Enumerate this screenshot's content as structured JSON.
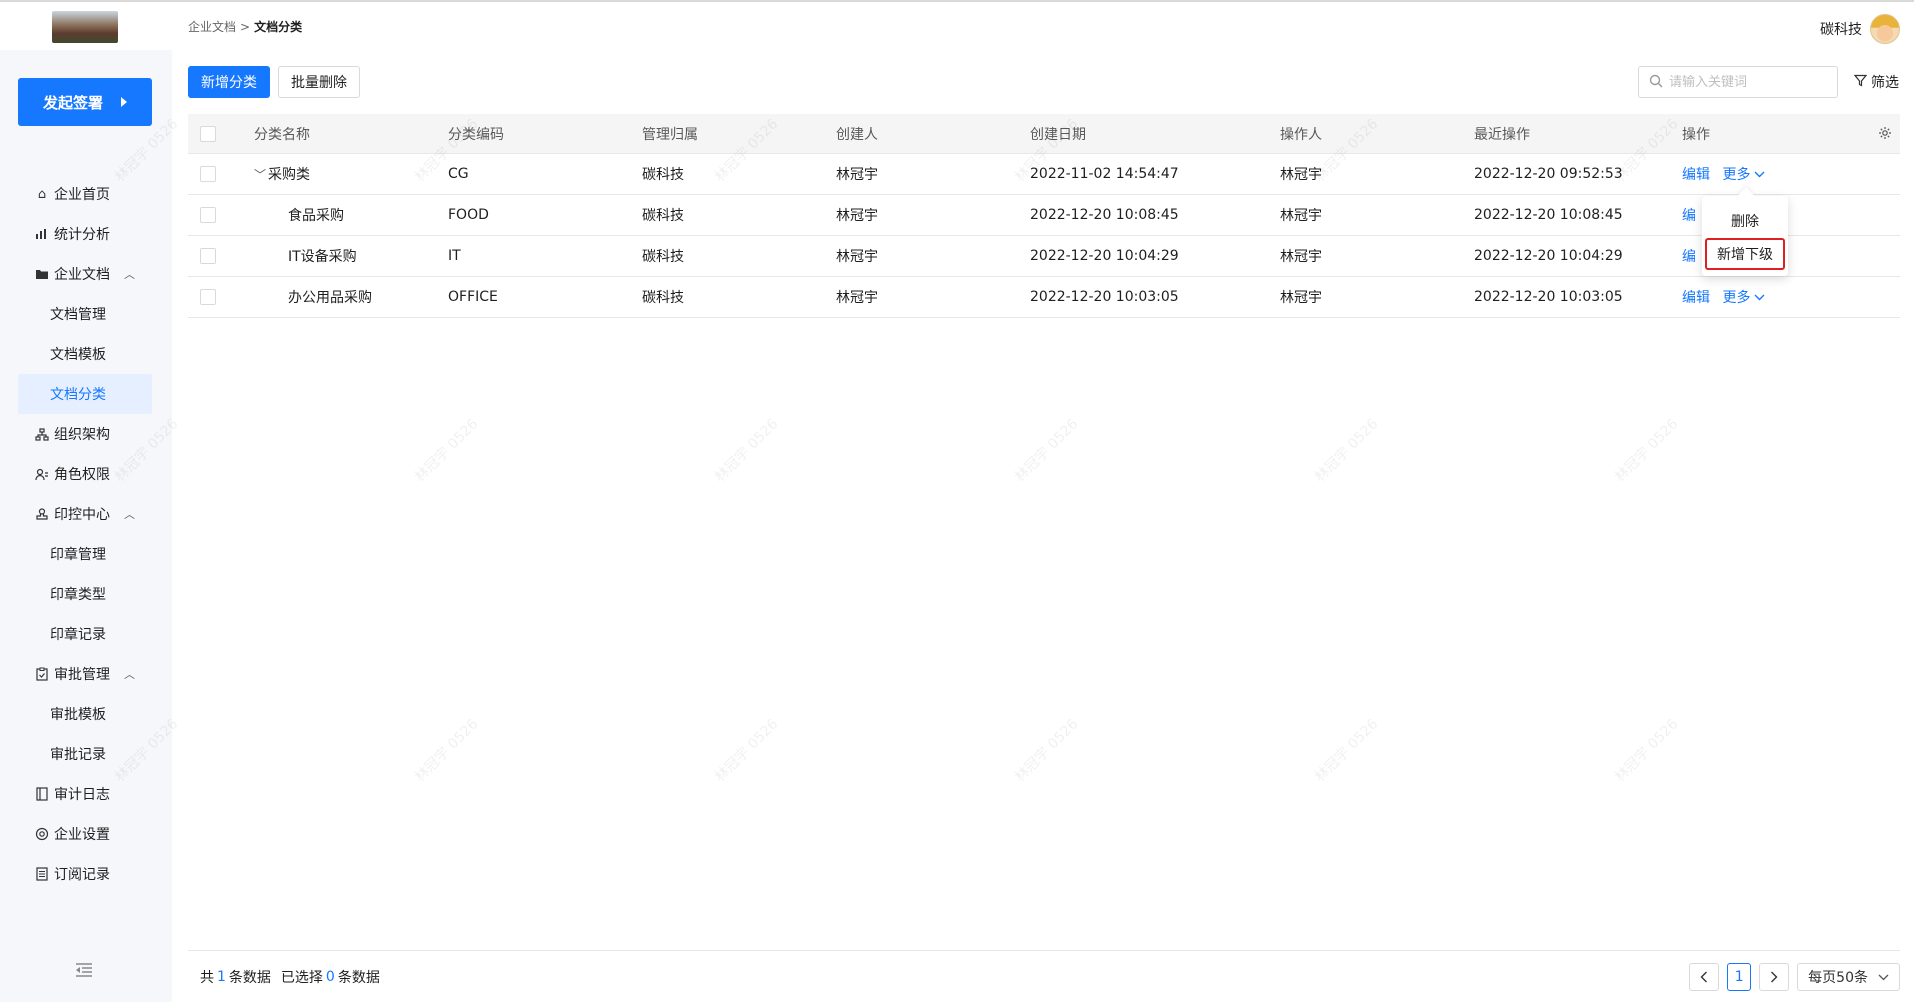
{
  "header": {
    "breadcrumb": [
      "企业文档",
      "文档分类"
    ],
    "breadcrumb_sep": ">",
    "company": "碳科技"
  },
  "sidebar": {
    "launch_label": "发起签署",
    "items": [
      {
        "label": "企业首页",
        "icon": "home-icon"
      },
      {
        "label": "统计分析",
        "icon": "chart-icon"
      },
      {
        "label": "企业文档",
        "icon": "folder-icon",
        "expanded": true
      },
      {
        "label": "文档管理",
        "sub": true
      },
      {
        "label": "文档模板",
        "sub": true
      },
      {
        "label": "文档分类",
        "sub": true,
        "active": true
      },
      {
        "label": "组织架构",
        "icon": "org-icon"
      },
      {
        "label": "角色权限",
        "icon": "role-icon"
      },
      {
        "label": "印控中心",
        "icon": "stamp-icon",
        "expanded": true
      },
      {
        "label": "印章管理",
        "sub": true
      },
      {
        "label": "印章类型",
        "sub": true
      },
      {
        "label": "印章记录",
        "sub": true
      },
      {
        "label": "审批管理",
        "icon": "clipboard-icon",
        "expanded": true
      },
      {
        "label": "审批模板",
        "sub": true
      },
      {
        "label": "审批记录",
        "sub": true
      },
      {
        "label": "审计日志",
        "icon": "book-icon"
      },
      {
        "label": "企业设置",
        "icon": "settings-icon"
      },
      {
        "label": "订阅记录",
        "icon": "list-icon"
      }
    ]
  },
  "toolbar": {
    "add_label": "新增分类",
    "batch_delete_label": "批量删除",
    "search_placeholder": "请输入关键词",
    "filter_label": "筛选"
  },
  "table": {
    "columns": [
      "分类名称",
      "分类编码",
      "管理归属",
      "创建人",
      "创建日期",
      "操作人",
      "最近操作",
      "操作"
    ],
    "rows": [
      {
        "name": "采购类",
        "code": "CG",
        "owner": "碳科技",
        "creator": "林冠宇",
        "created": "2022-11-02 14:54:47",
        "operator": "林冠宇",
        "last": "2022-12-20 09:52:53",
        "parent": true
      },
      {
        "name": "食品采购",
        "code": "FOOD",
        "owner": "碳科技",
        "creator": "林冠宇",
        "created": "2022-12-20 10:08:45",
        "operator": "林冠宇",
        "last": "2022-12-20 10:08:45"
      },
      {
        "name": "IT设备采购",
        "code": "IT",
        "owner": "碳科技",
        "creator": "林冠宇",
        "created": "2022-12-20 10:04:29",
        "operator": "林冠宇",
        "last": "2022-12-20 10:04:29"
      },
      {
        "name": "办公用品采购",
        "code": "OFFICE",
        "owner": "碳科技",
        "creator": "林冠宇",
        "created": "2022-12-20 10:03:05",
        "operator": "林冠宇",
        "last": "2022-12-20 10:03:05"
      }
    ],
    "action_edit": "编辑",
    "action_edit_truncated": "编",
    "action_more": "更多"
  },
  "dropdown": {
    "items": [
      "删除",
      "新增下级"
    ],
    "highlight_index": 1
  },
  "footer": {
    "total_prefix": "共",
    "total": "1",
    "total_suffix": "条数据",
    "selected_prefix": "已选择",
    "selected": "0",
    "selected_suffix": "条数据",
    "current_page": "1",
    "page_size": "每页50条"
  },
  "watermark": "林冠宇 0526",
  "colors": {
    "accent": "#1677ff",
    "highlight": "#e02020"
  }
}
